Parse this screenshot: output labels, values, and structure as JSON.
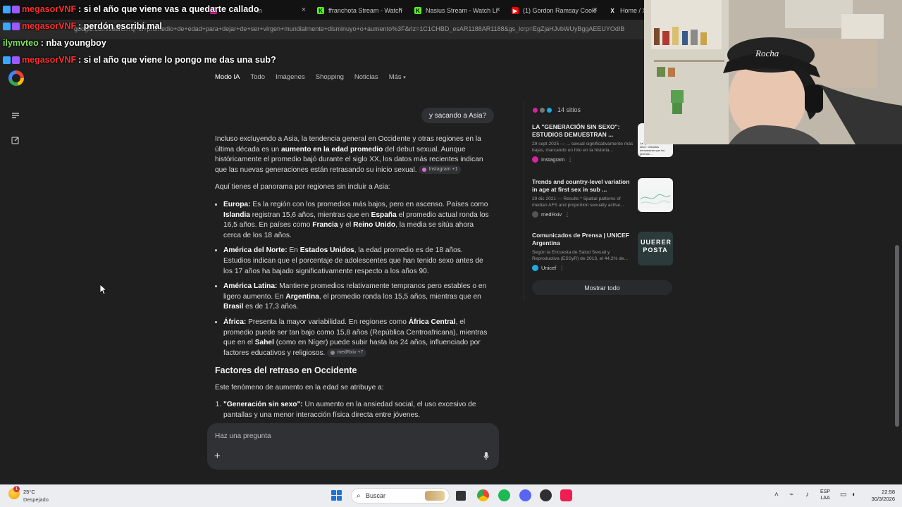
{
  "browser": {
    "tabs": [
      {
        "label": "m",
        "icon": "instagram-icon",
        "color": "#d6249f"
      },
      {
        "label": "ffranchota Stream - Watch",
        "icon": "kick-icon",
        "color": "#53fc18"
      },
      {
        "label": "Nasius Stream - Watch Li",
        "icon": "kick-icon",
        "color": "#53fc18"
      },
      {
        "label": "(1) Gordon Ramsay Cooki",
        "icon": "youtube-icon",
        "color": "#ff0000"
      },
      {
        "label": "Home / X",
        "icon": "x-icon",
        "color": "#000000"
      }
    ],
    "close_glyph": "×",
    "url": "google.com/search?q=el+promedio+de+edad+para+dejar+de+ser+virgen+mundialmente+disminuyo+o+aumento%3F&rlz=1C1CHBD_esAR1188AR1188&gs_lcrp=EgZjaHJvbWUyBggAEEUYOdIB"
  },
  "chat": [
    {
      "user": "megasorVNF",
      "user_color": "#ff3030",
      "message": ": si el año que viene vas a quedarte callado"
    },
    {
      "user": "megasorVNF",
      "user_color": "#ff3030",
      "message": ": perdón escribí mal"
    },
    {
      "user": "ilymvteo",
      "user_color": "#7fe05a",
      "message": ": nba youngboy"
    },
    {
      "user": "megasorVNF",
      "user_color": "#ff3030",
      "message": ": si el año que viene lo pongo me das una sub?"
    }
  ],
  "google": {
    "nav_tabs": [
      "Modo IA",
      "Todo",
      "Imágenes",
      "Shopping",
      "Noticias",
      "Más"
    ],
    "user_query": "y sacando a Asia?",
    "intro": {
      "t1": "Incluso excluyendo a Asia, la tendencia general en Occidente y otras regiones en la última década es un ",
      "b1": "aumento en la edad promedio",
      "t2": " del debut sexual. Aunque históricamente el promedio bajó durante el siglo XX, los datos más recientes indican que las nuevas generaciones están retrasando su inicio sexual.",
      "chip": "Instagram +1"
    },
    "panorama": "Aquí tienes el panorama por regiones sin incluir a Asia:",
    "regions": [
      {
        "parts": [
          [
            "b",
            "Europa:"
          ],
          [
            "t",
            " Es la región con los promedios más bajos, pero en ascenso. Países como "
          ],
          [
            "b",
            "Islandia"
          ],
          [
            "t",
            " registran 15,6 años, mientras que en "
          ],
          [
            "b",
            "España"
          ],
          [
            "t",
            " el promedio actual ronda los 16,5 años. En países como "
          ],
          [
            "b",
            "Francia"
          ],
          [
            "t",
            " y el "
          ],
          [
            "b",
            "Reino Unido"
          ],
          [
            "t",
            ", la media se sitúa ahora cerca de los 18 años."
          ]
        ]
      },
      {
        "parts": [
          [
            "b",
            "América del Norte:"
          ],
          [
            "t",
            " En "
          ],
          [
            "b",
            "Estados Unidos"
          ],
          [
            "t",
            ", la edad promedio es de 18 años. Estudios indican que el porcentaje de adolescentes que han tenido sexo antes de los 17 años ha bajado significativamente respecto a los años 90."
          ]
        ]
      },
      {
        "parts": [
          [
            "b",
            "América Latina:"
          ],
          [
            "t",
            " Mantiene promedios relativamente tempranos pero estables o en ligero aumento. En "
          ],
          [
            "b",
            "Argentina"
          ],
          [
            "t",
            ", el promedio ronda los 15,5 años, mientras que en "
          ],
          [
            "b",
            "Brasil"
          ],
          [
            "t",
            " es de 17,3 años."
          ]
        ]
      },
      {
        "parts": [
          [
            "b",
            "África:"
          ],
          [
            "t",
            " Presenta la mayor variabilidad. En regiones como "
          ],
          [
            "b",
            "África Central"
          ],
          [
            "t",
            ", el promedio puede ser tan bajo como 15,8 años (República Centroafricana), mientras que en el "
          ],
          [
            "b",
            "Sahel"
          ],
          [
            "t",
            " (como en Níger) puede subir hasta los 24 años, influenciado por factores educativos y religiosos."
          ]
        ],
        "chip": "medRxiv +7"
      }
    ],
    "section_title": "Factores del retraso en Occidente",
    "section_intro": "Este fenómeno de aumento en la edad se atribuye a:",
    "factors": [
      {
        "bold": "\"Generación sin sexo\":",
        "text": " Un aumento en la ansiedad social, el uso excesivo de pantallas y una menor interacción física directa entre jóvenes."
      }
    ],
    "ask_placeholder": "Haz una pregunta",
    "ask_plus": "+",
    "sources": {
      "count_label": "14 sitios",
      "items": [
        {
          "title": "LA \"GENERACIÓN SIN SEXO\": ESTUDIOS DEMUESTRAN ...",
          "snippet": "29 sept 2025 — ... sexual significativamente más bajas, marcando un hito en la historia...",
          "site": "Instagram",
          "site_color": "#d6249f",
          "thumb_text": "La \"generación sin sexo\": estudios demuestran que los jóvenes ..."
        },
        {
          "title": "Trends and country-level variation in age at first sex in sub ...",
          "snippet": "29 dic 2021 — Results * Spatial patterns of median AFS and proportion sexually active...",
          "site": "medRxiv",
          "site_color": "#555555",
          "thumb_text": ""
        },
        {
          "title": "Comunicados de Prensa | UNICEF Argentina",
          "snippet": "Según la Encuesta de Salud Sexual y Reproductiva (ESSyR) de 2013, el 44,2% de...",
          "site": "Unicef",
          "site_color": "#1cabe2",
          "thumb_text": "UUERER POSTA"
        }
      ],
      "show_all": "Mostrar todo"
    }
  },
  "taskbar": {
    "temp": "25°C",
    "condition": "Despejado",
    "weather_badge": "1",
    "search_label": "Buscar",
    "lang_top": "ESP",
    "lang_bottom": "LAA",
    "time": "22:58",
    "date": "30/3/2026"
  }
}
